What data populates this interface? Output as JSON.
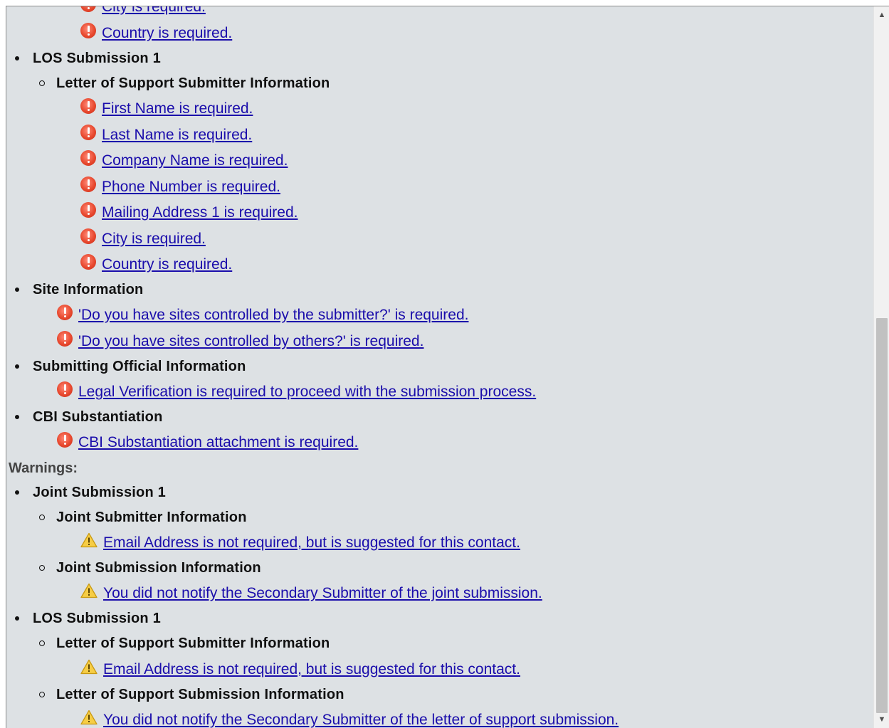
{
  "errors_partial": {
    "city_msg": "City is required.",
    "country_msg": "Country is required."
  },
  "los_submission": {
    "title": "LOS Submission 1",
    "submitter_info_heading": "Letter of Support Submitter Information",
    "messages": [
      "First Name is required.",
      "Last Name is required.",
      "Company Name is required.",
      "Phone Number is required.",
      "Mailing Address 1 is required.",
      "City is required.",
      "Country is required."
    ]
  },
  "site_information": {
    "title": "Site Information",
    "messages": [
      "'Do you have sites controlled by the submitter?' is required.",
      "'Do you have sites controlled by others?' is required."
    ]
  },
  "submitting_official": {
    "title": "Submitting Official Information",
    "messages": [
      "Legal Verification is required to proceed with the submission process."
    ]
  },
  "cbi_substantiation": {
    "title": "CBI Substantiation",
    "messages": [
      "CBI Substantiation attachment is required."
    ]
  },
  "warnings": {
    "label": "Warnings:",
    "joint_submission": {
      "title": "Joint Submission 1",
      "joint_submitter_heading": "Joint Submitter Information",
      "joint_submitter_msg": "Email Address is not required, but is suggested for this contact.",
      "joint_submission_heading": "Joint Submission Information",
      "joint_submission_msg": "You did not notify the Secondary Submitter of the joint submission."
    },
    "los_submission": {
      "title": "LOS Submission 1",
      "submitter_info_heading": "Letter of Support Submitter Information",
      "submitter_info_msg": "Email Address is not required, but is suggested for this contact.",
      "submission_info_heading": "Letter of Support Submission Information",
      "submission_info_msg": "You did not notify the Secondary Submitter of the letter of support submission."
    }
  },
  "icons": {
    "error": "error-circle-icon",
    "warning": "warning-triangle-icon",
    "scroll_up": "scroll-up-arrow-icon",
    "scroll_down": "scroll-down-arrow-icon"
  },
  "colors": {
    "panel_bg": "#dde1e4",
    "link": "#1a0dab",
    "error_red": "#e8492f",
    "warning_yellow": "#f2c12e"
  }
}
